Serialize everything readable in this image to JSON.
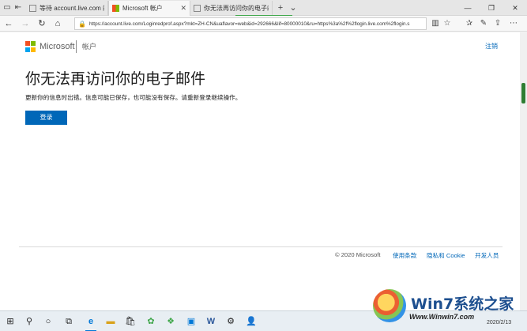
{
  "browser": {
    "tabs": [
      {
        "label": "等待 account.live.com 的应"
      },
      {
        "label": "Microsoft 帐户"
      },
      {
        "label": "你无法再访问你的电子邮件"
      }
    ],
    "url": "https://account.live.com/Loginredprof.aspx?mkt=ZH-CN&uaflavor=web&id=292666&lif=80000010&ru=https%3a%2f%2flogin.live.com%2flogin.s"
  },
  "page": {
    "brand": "Microsoft",
    "section": "帐户",
    "signout": "注销",
    "heading": "你无法再访问你的电子邮件",
    "description": "更新你的信息时出错。信息可能已保存，也可能没有保存。请重新登录继续操作。",
    "login_button": "登录",
    "footer": {
      "copyright": "© 2020 Microsoft",
      "links": [
        "使用条款",
        "隐私和 Cookie",
        "开发人员"
      ]
    }
  },
  "watermark": {
    "brand": "Win7系统之家",
    "site": "Www.Winwin7.com"
  },
  "taskbar": {
    "date": "2020/2/13"
  },
  "colors": {
    "accent": "#0067b8",
    "logo_red": "#f25022",
    "logo_green": "#7fba00",
    "logo_blue": "#00a4ef",
    "logo_yellow": "#ffb900"
  }
}
